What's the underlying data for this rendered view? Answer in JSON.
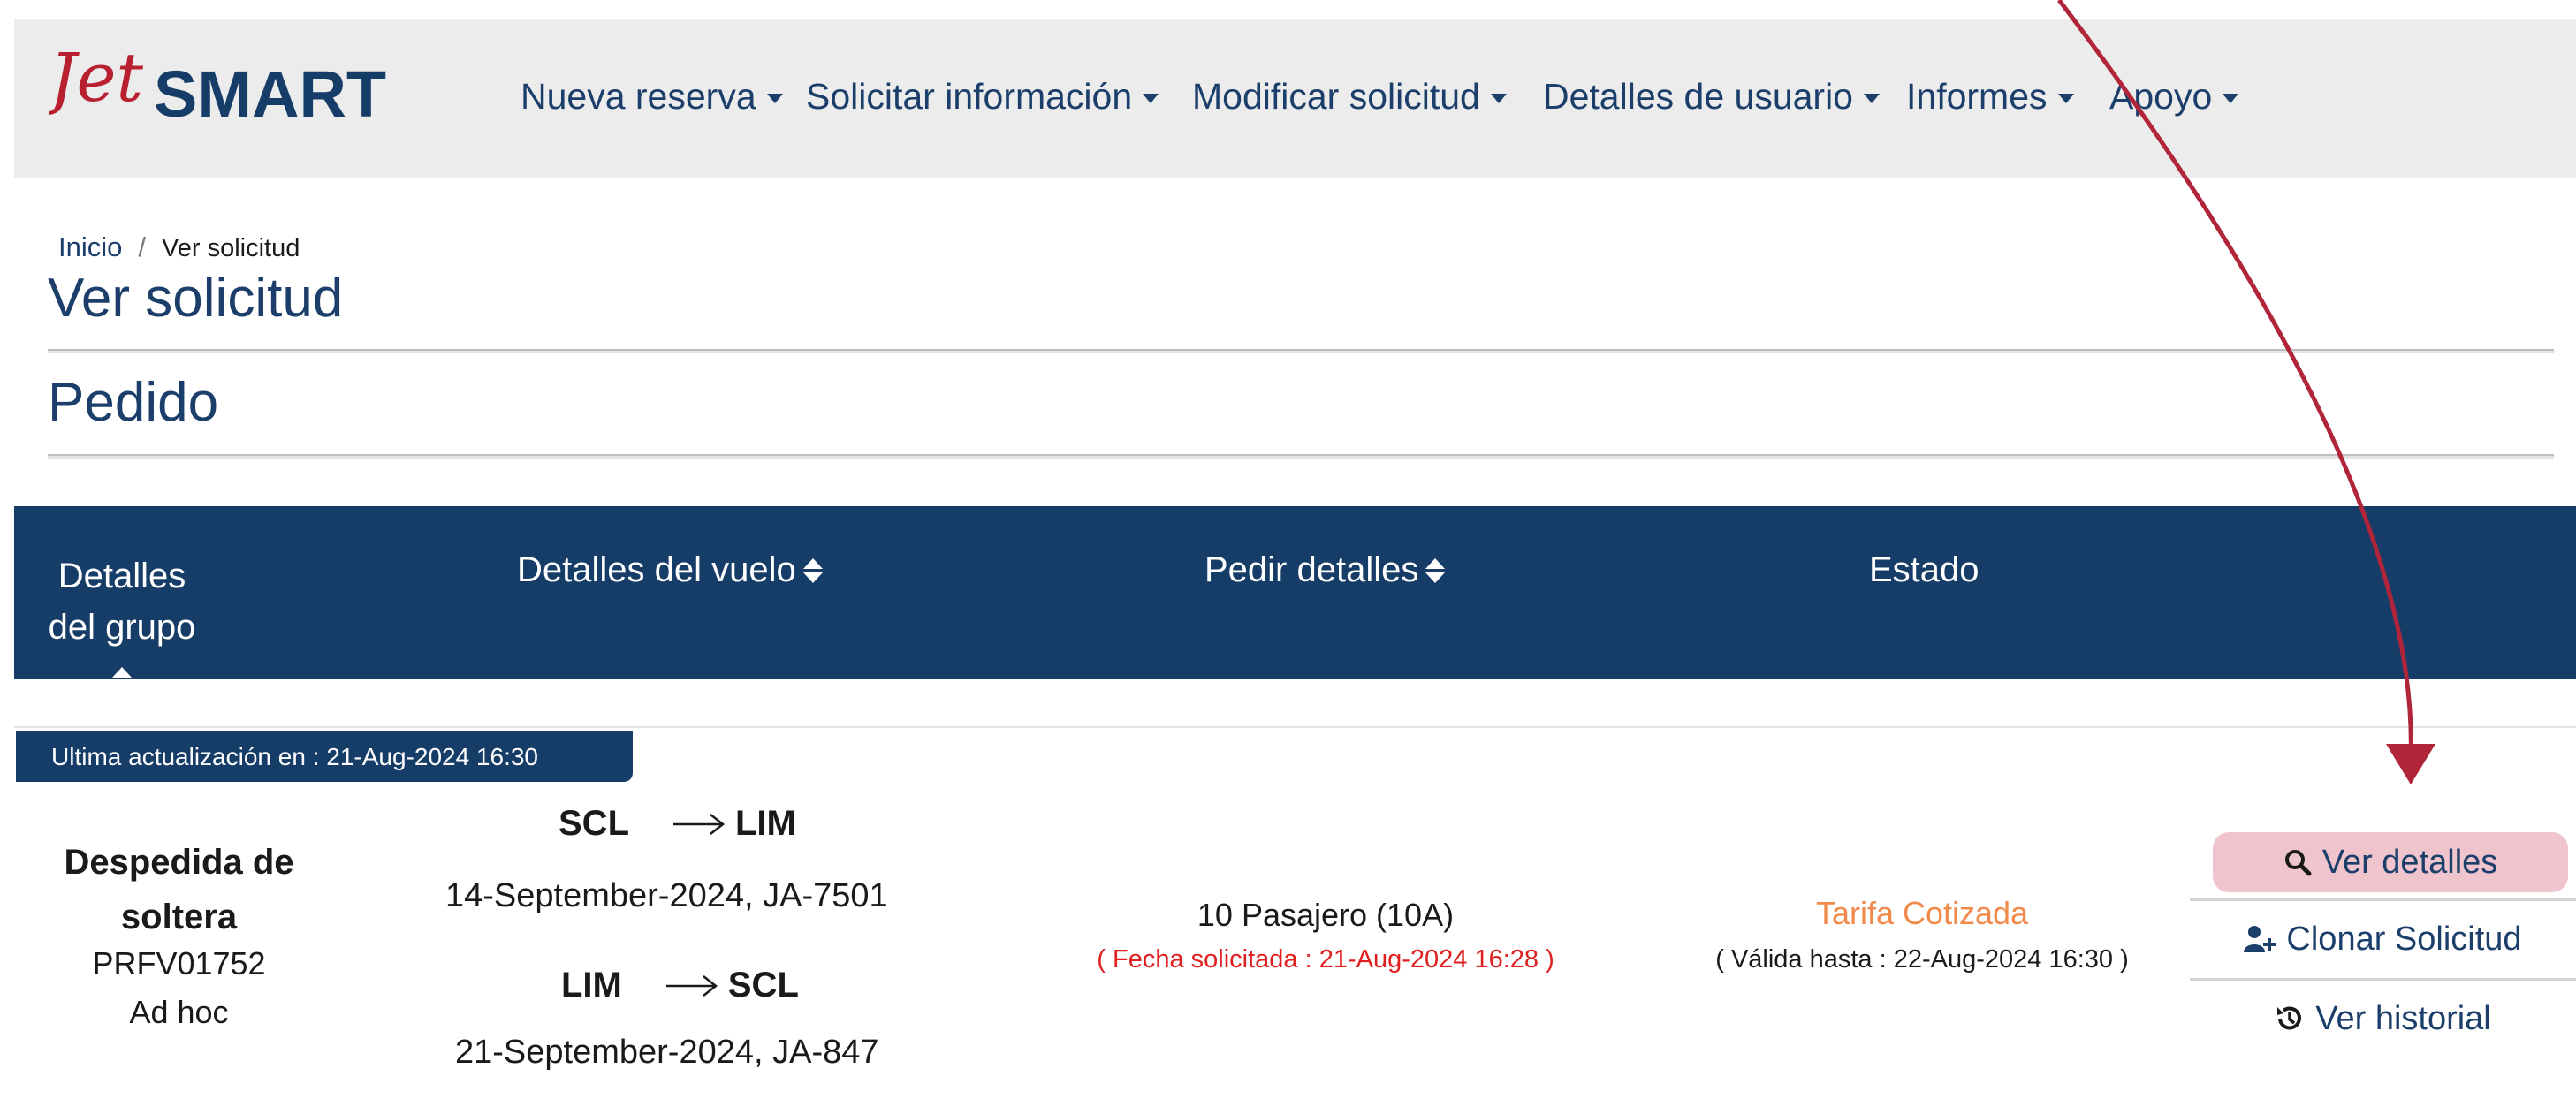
{
  "brand": {
    "logo_text_jet": "Jet",
    "logo_text_smart": "SMART",
    "color_primary": "#163d68",
    "color_logo_red": "#b8202f"
  },
  "nav": {
    "items": [
      {
        "label": "Nueva reserva"
      },
      {
        "label": "Solicitar información"
      },
      {
        "label": "Modificar solicitud"
      },
      {
        "label": "Detalles de usuario"
      },
      {
        "label": "Informes"
      },
      {
        "label": "Apoyo"
      }
    ]
  },
  "breadcrumb": {
    "home": "Inicio",
    "separator": "/",
    "current": "Ver solicitud"
  },
  "page": {
    "title": "Ver solicitud",
    "section_title": "Pedido"
  },
  "table": {
    "headers": [
      {
        "label": "Detalles del grupo",
        "sortable": true
      },
      {
        "label": "Detalles del vuelo",
        "sortable": true
      },
      {
        "label": "Pedir detalles",
        "sortable": true
      },
      {
        "label": "Estado",
        "sortable": false
      }
    ],
    "rows": [
      {
        "updated": "Ultima actualización en : 21-Aug-2024 16:30",
        "group": {
          "name": "Despedida de soltera",
          "ref": "PRFV01752",
          "type": "Ad hoc"
        },
        "flights": [
          {
            "from": "SCL",
            "to": "LIM",
            "date_flight": "14-September-2024, JA-7501"
          },
          {
            "from": "LIM",
            "to": "SCL",
            "date_flight": "21-September-2024, JA-847"
          }
        ],
        "order": {
          "passengers": "10 Pasajero (10A)",
          "requested": "( Fecha solicitada : 21-Aug-2024 16:28 )"
        },
        "status": {
          "label": "Tarifa Cotizada",
          "valid_until": "( Válida hasta : 22-Aug-2024 16:30 )",
          "color": "#f08a4b"
        },
        "actions": {
          "view": "Ver detalles",
          "clone": "Clonar Solicitud",
          "history": "Ver historial"
        }
      }
    ]
  },
  "annotation": {
    "color": "#b0253a",
    "target": "Ver detalles"
  }
}
